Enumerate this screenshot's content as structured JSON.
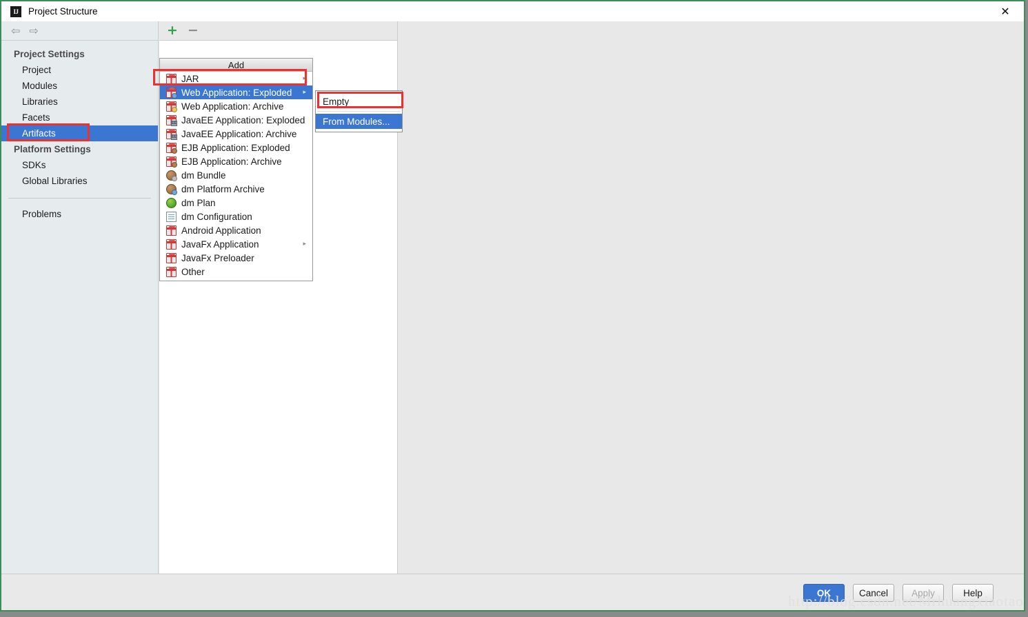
{
  "window": {
    "title": "Project Structure",
    "logo_text": "IJ",
    "close_label": "✕"
  },
  "nav": {
    "back_icon": "⇦",
    "forward_icon": "⇨"
  },
  "sidebar": {
    "groups": [
      {
        "title": "Project Settings",
        "items": [
          {
            "label": "Project",
            "selected": false
          },
          {
            "label": "Modules",
            "selected": false
          },
          {
            "label": "Libraries",
            "selected": false
          },
          {
            "label": "Facets",
            "selected": false
          },
          {
            "label": "Artifacts",
            "selected": true
          }
        ]
      },
      {
        "title": "Platform Settings",
        "items": [
          {
            "label": "SDKs",
            "selected": false
          },
          {
            "label": "Global Libraries",
            "selected": false
          }
        ]
      }
    ],
    "problems_label": "Problems"
  },
  "toolbar": {
    "add_icon": "+",
    "remove_icon": "−"
  },
  "add_menu": {
    "header": "Add",
    "items": [
      {
        "label": "JAR",
        "icon": "gift-icon",
        "has_arrow": true,
        "selected": false
      },
      {
        "label": "Web Application: Exploded",
        "icon": "gift-web-icon",
        "has_arrow": true,
        "selected": true
      },
      {
        "label": "Web Application: Archive",
        "icon": "gift-web-archive-icon",
        "has_arrow": false,
        "selected": false
      },
      {
        "label": "JavaEE Application: Exploded",
        "icon": "gift-javaee-icon",
        "has_arrow": false,
        "selected": false
      },
      {
        "label": "JavaEE Application: Archive",
        "icon": "gift-javaee-icon",
        "has_arrow": false,
        "selected": false
      },
      {
        "label": "EJB Application: Exploded",
        "icon": "gift-ejb-icon",
        "has_arrow": false,
        "selected": false
      },
      {
        "label": "EJB Application: Archive",
        "icon": "gift-ejb-icon",
        "has_arrow": false,
        "selected": false
      },
      {
        "label": "dm Bundle",
        "icon": "sphere-icon",
        "has_arrow": false,
        "selected": false
      },
      {
        "label": "dm Platform Archive",
        "icon": "sphere-archive-icon",
        "has_arrow": false,
        "selected": false
      },
      {
        "label": "dm Plan",
        "icon": "leaf-icon",
        "has_arrow": false,
        "selected": false
      },
      {
        "label": "dm Configuration",
        "icon": "document-icon",
        "has_arrow": false,
        "selected": false
      },
      {
        "label": "Android Application",
        "icon": "gift-icon",
        "has_arrow": false,
        "selected": false
      },
      {
        "label": "JavaFx Application",
        "icon": "gift-icon",
        "has_arrow": true,
        "selected": false
      },
      {
        "label": "JavaFx Preloader",
        "icon": "gift-icon",
        "has_arrow": false,
        "selected": false
      },
      {
        "label": "Other",
        "icon": "gift-icon",
        "has_arrow": false,
        "selected": false
      }
    ]
  },
  "submenu": {
    "items": [
      {
        "label": "Empty",
        "selected": false
      },
      {
        "label": "From Modules...",
        "selected": true
      }
    ]
  },
  "footer": {
    "buttons": [
      {
        "label": "OK",
        "style": "primary"
      },
      {
        "label": "Cancel",
        "style": "normal"
      },
      {
        "label": "Apply",
        "style": "disabled"
      },
      {
        "label": "Help",
        "style": "normal"
      }
    ]
  },
  "watermark": "http://blog.csdn.net/Mrhuangxiaotao",
  "colors": {
    "accent": "#3b77d2",
    "highlight_box": "#ef3030",
    "window_border": "#3c8d5a",
    "add_icon": "#2fa34a"
  }
}
